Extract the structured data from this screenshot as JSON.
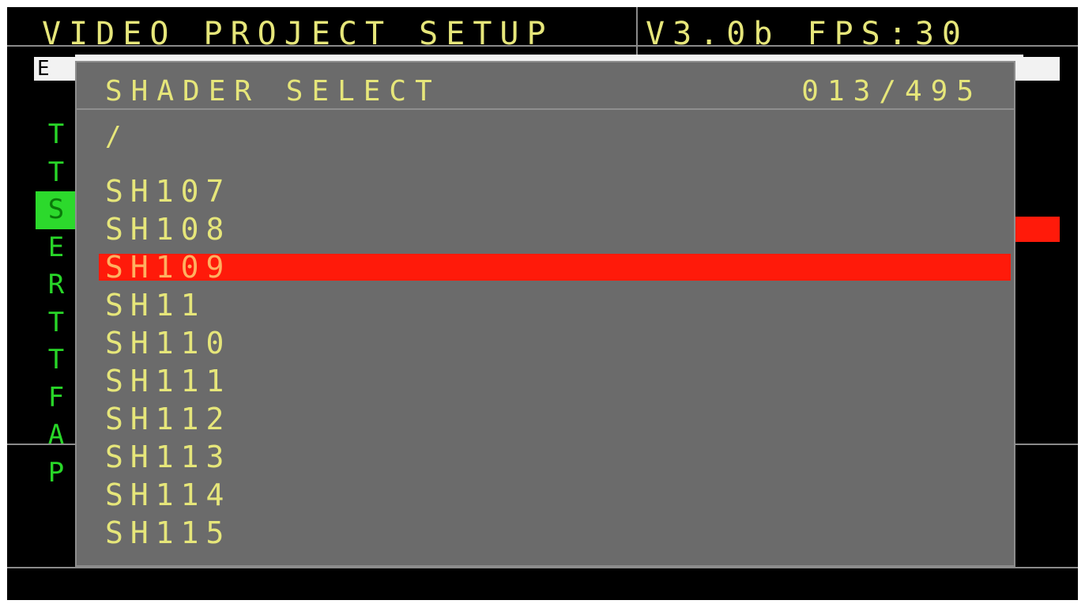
{
  "header": {
    "title": "VIDEO PROJECT SETUP",
    "version_fps": "V3.0b FPS:30"
  },
  "background_field": {
    "left_text": "E"
  },
  "side_menu": {
    "letters": [
      "T",
      "T",
      "S",
      "E",
      "R",
      "T",
      "T",
      "F",
      "A",
      "P"
    ],
    "active_index": 2
  },
  "dialog": {
    "title": "SHADER SELECT",
    "counter": "013/495",
    "path": "/",
    "items": [
      "SH107",
      "SH108",
      "SH109",
      "SH11",
      "SH110",
      "SH111",
      "SH112",
      "SH113",
      "SH114",
      "SH115"
    ],
    "selected_index": 2
  },
  "colors": {
    "text_yellow": "#e6e67a",
    "menu_green": "#28d628",
    "highlight_red": "#ff1a0a",
    "dialog_gray": "#6b6b6b",
    "background": "#000000"
  }
}
